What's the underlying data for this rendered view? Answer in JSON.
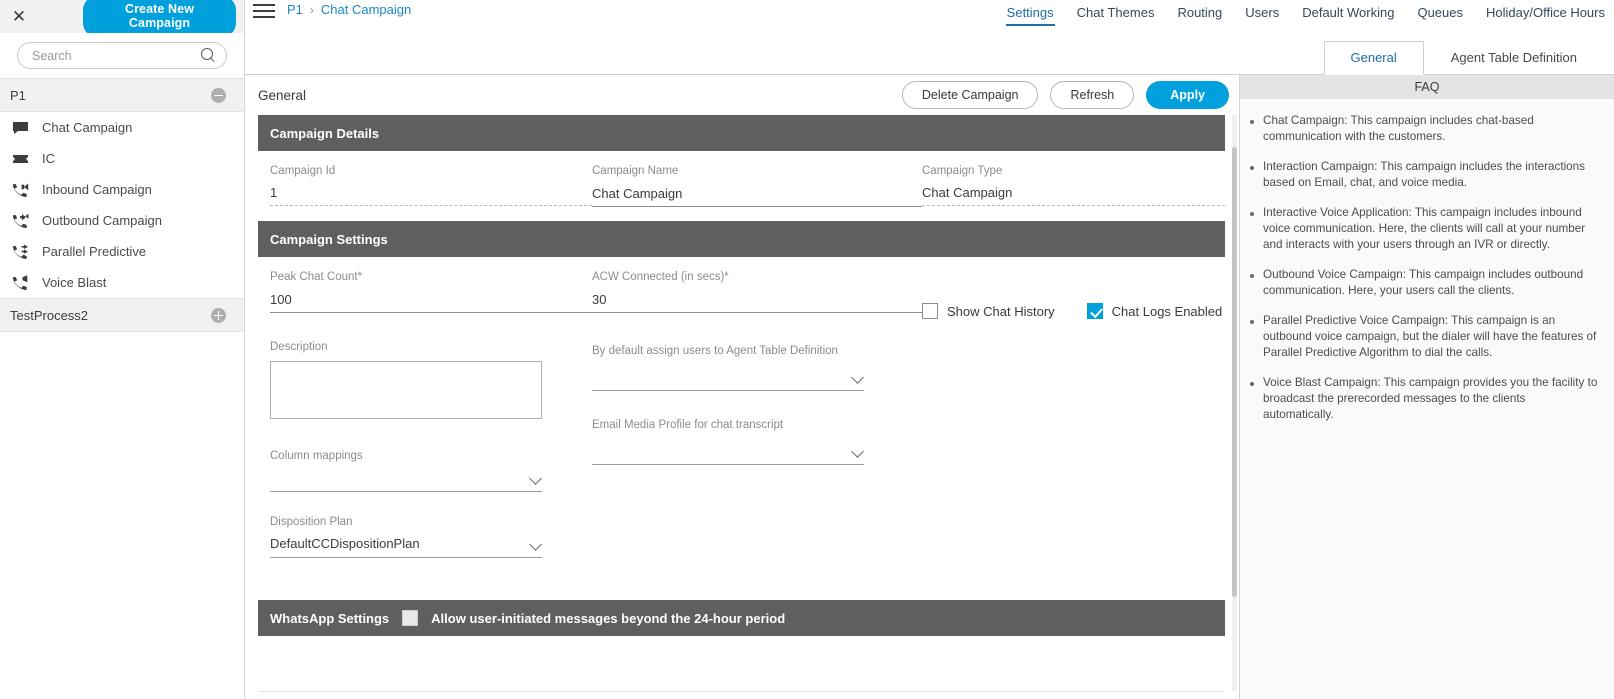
{
  "sidebar": {
    "close_icon": "close-icon",
    "create_button": "Create New Campaign",
    "search": {
      "value": "",
      "placeholder": "Search",
      "icon": "search-icon"
    },
    "groups": [
      {
        "name": "P1",
        "toggle": "collapse",
        "items": [
          {
            "label": "Chat Campaign",
            "icon": "chat-bubble-icon"
          },
          {
            "label": "IC",
            "icon": "interaction-ticket-icon"
          },
          {
            "label": "Inbound Campaign",
            "icon": "phone-inbound-icon"
          },
          {
            "label": "Outbound Campaign",
            "icon": "phone-outbound-icon"
          },
          {
            "label": "Parallel Predictive",
            "icon": "phone-parallel-icon"
          },
          {
            "label": "Voice Blast",
            "icon": "phone-megaphone-icon"
          }
        ]
      },
      {
        "name": "TestProcess2",
        "toggle": "expand",
        "items": []
      }
    ]
  },
  "topbar": {
    "menu_icon": "hamburger-menu-icon",
    "breadcrumb": [
      "P1",
      "Chat Campaign"
    ],
    "breadcrumb_separator": "›",
    "nav_tabs": [
      {
        "label": "Settings",
        "active": true
      },
      {
        "label": "Chat Themes",
        "active": false
      },
      {
        "label": "Routing",
        "active": false
      },
      {
        "label": "Users",
        "active": false
      },
      {
        "label": "Default Working",
        "active": false
      },
      {
        "label": "Queues",
        "active": false
      },
      {
        "label": "Holiday/Office Hours",
        "active": false
      }
    ],
    "sub_tabs": [
      {
        "label": "General",
        "active": true
      },
      {
        "label": "Agent Table Definition",
        "active": false
      }
    ]
  },
  "form": {
    "title": "General",
    "buttons": {
      "delete": "Delete Campaign",
      "refresh": "Refresh",
      "apply": "Apply"
    },
    "campaign_details": {
      "section_title": "Campaign Details",
      "campaign_id": {
        "label": "Campaign Id",
        "value": "1"
      },
      "campaign_name": {
        "label": "Campaign Name",
        "value": "Chat Campaign"
      },
      "campaign_type": {
        "label": "Campaign Type",
        "value": "Chat Campaign"
      }
    },
    "campaign_settings": {
      "section_title": "Campaign Settings",
      "peak_chat_count": {
        "label": "Peak Chat Count*",
        "value": "100"
      },
      "acw_connected": {
        "label": "ACW Connected (in secs)*",
        "value": "30"
      },
      "description": {
        "label": "Description",
        "value": "",
        "placeholder": ""
      },
      "column_mappings": {
        "label": "Column mappings",
        "value": ""
      },
      "disposition_plan": {
        "label": "Disposition Plan",
        "value": "DefaultCCDispositionPlan"
      },
      "agent_table_definition": {
        "label": "By default assign users to Agent Table Definition",
        "value": ""
      },
      "email_media_profile": {
        "label": "Email Media Profile for chat transcript",
        "value": ""
      },
      "show_chat_history": {
        "label": "Show Chat History",
        "checked": false
      },
      "chat_logs_enabled": {
        "label": "Chat Logs Enabled",
        "checked": true
      }
    },
    "whatsapp_settings": {
      "section_title": "WhatsApp Settings",
      "allow_label": "Allow user-initiated messages beyond the 24-hour period",
      "allow_checked": false
    }
  },
  "faq": {
    "title": "FAQ",
    "items": [
      "Chat Campaign: This campaign includes chat-based communication with the customers.",
      "Interaction Campaign: This campaign includes the interactions based on Email, chat, and voice media.",
      "Interactive Voice Application: This campaign includes inbound voice communication. Here, the clients will call at your number and interacts with your users through an IVR or directly.",
      "Outbound Voice Campaign: This campaign includes outbound communication. Here, your users call the clients.",
      "Parallel Predictive Voice Campaign: This campaign is an outbound voice campaign, but the dialer will have the features of Parallel Predictive Algorithm to dial the calls.",
      "Voice Blast Campaign: This campaign provides you the facility to broadcast the prerecorded messages to the clients automatically."
    ]
  },
  "colors": {
    "accent": "#00a0dd",
    "link": "#1e88c7",
    "section_bar": "#5f5f5f",
    "active_tab": "#1e6ea7"
  }
}
